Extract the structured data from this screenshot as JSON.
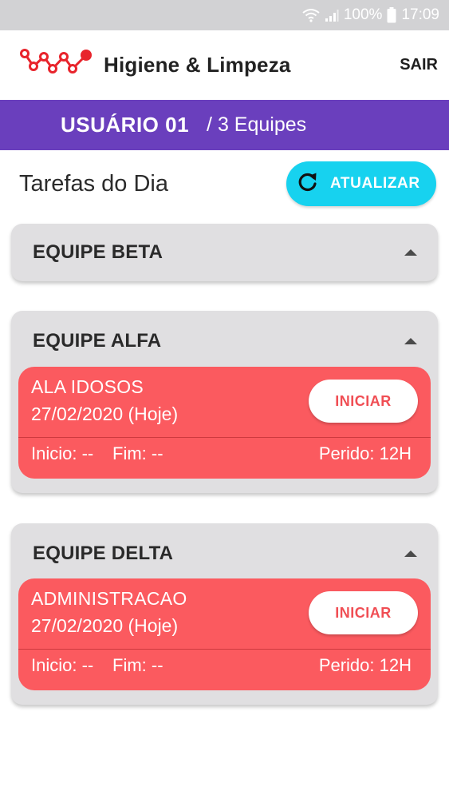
{
  "status_bar": {
    "battery": "100%",
    "time": "17:09"
  },
  "header": {
    "title": "Higiene & Limpeza",
    "logout_label": "SAIR",
    "logo_icon": "network-logo-icon"
  },
  "user_bar": {
    "user": "USUÁRIO 01",
    "teams": "/ 3 Equipes"
  },
  "tasks_section": {
    "title": "Tarefas do Dia",
    "refresh_label": "ATUALIZAR",
    "refresh_icon": "refresh-icon"
  },
  "teams": [
    {
      "name": "EQUIPE BETA",
      "tasks": []
    },
    {
      "name": "EQUIPE ALFA",
      "tasks": [
        {
          "name": "ALA IDOSOS",
          "date": "27/02/2020 (Hoje)",
          "start_button": "INICIAR",
          "start": "Inicio: --",
          "end": "Fim: --",
          "period": "Perido: 12H"
        }
      ]
    },
    {
      "name": "EQUIPE DELTA",
      "tasks": [
        {
          "name": "ADMINISTRACAO",
          "date": "27/02/2020 (Hoje)",
          "start_button": "INICIAR",
          "start": "Inicio: --",
          "end": "Fim: --",
          "period": "Perido: 12H"
        }
      ]
    }
  ],
  "colors": {
    "accent_purple": "#6a3fbd",
    "refresh_cyan": "#17d2ef",
    "task_red": "#fb5a5f",
    "logo_red": "#e8242c"
  }
}
